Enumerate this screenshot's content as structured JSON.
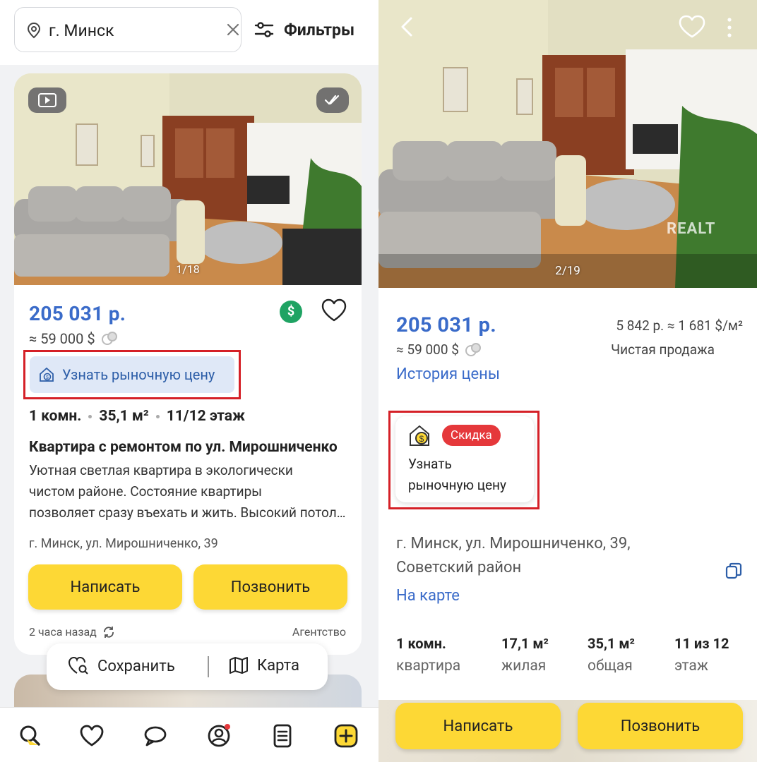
{
  "left": {
    "search": {
      "city": "г. Минск"
    },
    "filters_label": "Фильтры",
    "listing": {
      "photo_counter": "1/18",
      "price": "205 031 р.",
      "usd_price": "≈ 59 000 $",
      "market_price_label": "Узнать рыночную цену",
      "specs": {
        "rooms": "1 комн.",
        "area": "35,1 м²",
        "floor": "11/12 этаж"
      },
      "title": "Квартира с ремонтом по ул. Мирошниченко",
      "description": [
        "Уютная светлая квартира в экологически",
        "чистом районе. Состояние квартиры",
        "позволяет сразу въехать и жить. Высокий потолок"
      ],
      "address": "г. Минск, ул. Мирошниченко, 39",
      "write_label": "Написать",
      "call_label": "Позвонить",
      "posted": "2 часа назад",
      "agency": "Агентство"
    },
    "savebar": {
      "save_label": "Сохранить",
      "map_label": "Карта"
    }
  },
  "right": {
    "photo_counter": "2/19",
    "watermark": "REALT",
    "price": "205 031 р.",
    "usd_price": "≈ 59 000 $",
    "price_history_label": "История цены",
    "price_per_m2": "5 842 р. ≈ 1 681 $/м²",
    "sale_type": "Чистая продажа",
    "market_card": {
      "discount_badge": "Скидка",
      "line1": "Узнать",
      "line2": "рыночную цену"
    },
    "address_line1": "г. Минск, ул. Мирошниченко, 39,",
    "address_line2": "Советский район",
    "on_map_label": "На карте",
    "specs": [
      {
        "value": "1 комн.",
        "label": "квартира"
      },
      {
        "value": "17,1 м²",
        "label": "жилая"
      },
      {
        "value": "35,1 м²",
        "label": "общая"
      },
      {
        "value": "11 из 12",
        "label": "этаж"
      }
    ],
    "write_label": "Написать",
    "call_label": "Позвонить"
  },
  "colors": {
    "accent_blue": "#3a6bc9",
    "button_yellow": "#fdd835",
    "discount_red": "#e5383b",
    "highlight_red": "#d52027",
    "green_badge": "#1fa363"
  }
}
